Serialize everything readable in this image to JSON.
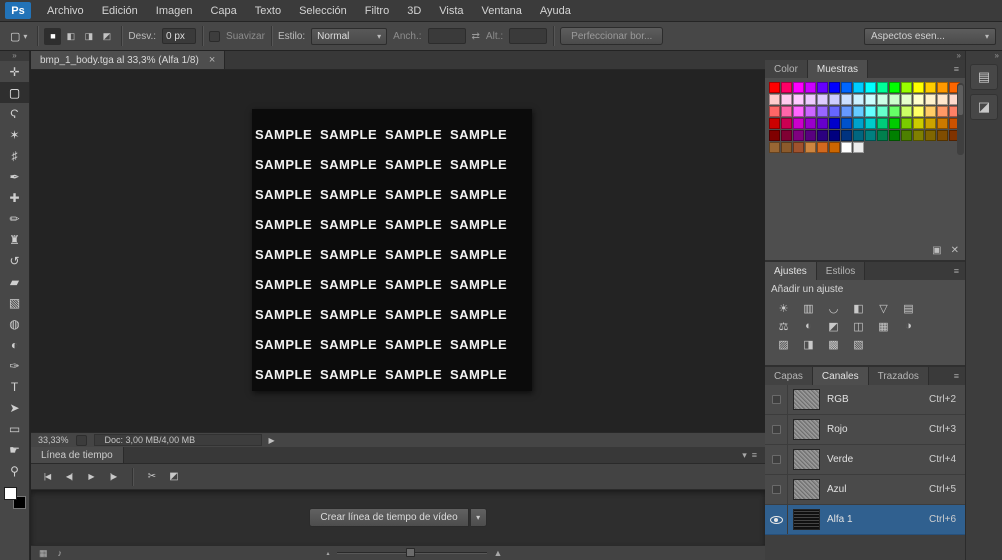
{
  "colors": {
    "selection_blue": "#30608f",
    "canvas_black": "#0b0b0b",
    "ui_gray": "#474747"
  },
  "ui_icons": {
    "dropdown": "▾",
    "panel_menu": "≡",
    "collapse": "»",
    "tool_preset": "▢",
    "swap": "⇄",
    "scissors": "✂",
    "transition": "◩",
    "status_arrow": "▶",
    "mountain_small": "▴",
    "mountain_large": "▲",
    "tab_close": "×"
  },
  "menu_bar": {
    "logo": "Ps",
    "menus": [
      "Archivo",
      "Edición",
      "Imagen",
      "Capa",
      "Texto",
      "Selección",
      "Filtro",
      "3D",
      "Vista",
      "Ventana",
      "Ayuda"
    ]
  },
  "options_bar": {
    "selection_modes": [
      {
        "name": "new-selection",
        "glyph": "■"
      },
      {
        "name": "add-to-selection",
        "glyph": "◧"
      },
      {
        "name": "subtract-from-selection",
        "glyph": "◨"
      },
      {
        "name": "intersect-selection",
        "glyph": "◩"
      }
    ],
    "feather_label": "Desv.:",
    "feather_value": "0 px",
    "antialias_label": "Suavizar",
    "style_label": "Estilo:",
    "style_value": "Normal",
    "width_label": "Anch.:",
    "width_value": "",
    "height_label": "Alt.:",
    "height_value": "",
    "refine_edge_label": "Perfeccionar bor...",
    "workspace_label": "Aspectos esen..."
  },
  "toolbar": {
    "tools": [
      {
        "name": "move-tool",
        "glyph": "✛"
      },
      {
        "name": "rectangular-marquee-tool",
        "glyph": "▢",
        "selected": true
      },
      {
        "name": "lasso-tool",
        "glyph": "Ϛ"
      },
      {
        "name": "quick-selection-tool",
        "glyph": "✶"
      },
      {
        "name": "crop-tool",
        "glyph": "♯"
      },
      {
        "name": "eyedropper-tool",
        "glyph": "✒"
      },
      {
        "name": "healing-brush-tool",
        "glyph": "✚"
      },
      {
        "name": "brush-tool",
        "glyph": "✏"
      },
      {
        "name": "clone-stamp-tool",
        "glyph": "♜"
      },
      {
        "name": "history-brush-tool",
        "glyph": "↺"
      },
      {
        "name": "eraser-tool",
        "glyph": "▰"
      },
      {
        "name": "gradient-tool",
        "glyph": "▧"
      },
      {
        "name": "blur-tool",
        "glyph": "◍"
      },
      {
        "name": "dodge-tool",
        "glyph": "◐"
      },
      {
        "name": "pen-tool",
        "glyph": "✑"
      },
      {
        "name": "type-tool",
        "glyph": "T"
      },
      {
        "name": "path-selection-tool",
        "glyph": "➤"
      },
      {
        "name": "shape-tool",
        "glyph": "▭"
      },
      {
        "name": "hand-tool",
        "glyph": "☛"
      },
      {
        "name": "zoom-tool",
        "glyph": "⚲"
      }
    ]
  },
  "document": {
    "tab_title": "bmp_1_body.tga al 33,3% (Alfa 1/8)",
    "canvas": {
      "text": "SAMPLE",
      "rows": 9,
      "cols": 4
    },
    "zoom_level": "33,33%",
    "doc_info": "Doc: 3,00 MB/4,00 MB"
  },
  "timeline": {
    "tab_label": "Línea de tiempo",
    "transport": [
      {
        "name": "first-frame",
        "glyph": "|◀"
      },
      {
        "name": "previous-frame",
        "glyph": "◀|"
      },
      {
        "name": "play",
        "glyph": "▶"
      },
      {
        "name": "next-frame",
        "glyph": "|▶"
      }
    ],
    "create_button_label": "Crear línea de tiempo de vídeo",
    "bottom_icons": [
      {
        "name": "timeline-frames",
        "glyph": "▦"
      },
      {
        "name": "timeline-audio",
        "glyph": "♪"
      }
    ]
  },
  "panels": {
    "color_panel": {
      "tabs": [
        {
          "label": "Color",
          "active": false
        },
        {
          "label": "Muestras",
          "active": true
        }
      ],
      "swatch_rows": [
        [
          "#ff0000",
          "#ff0066",
          "#ff00ff",
          "#cc00ff",
          "#6600ff",
          "#0000ff",
          "#0066ff",
          "#00ccff",
          "#00ffff",
          "#00ff99",
          "#00ff00",
          "#99ff00",
          "#ffff00",
          "#ffcc00",
          "#ff9900",
          "#ff6600"
        ],
        [
          "#ffcccc",
          "#ffccee",
          "#ffccff",
          "#eeccff",
          "#ddccff",
          "#ccccff",
          "#cce0ff",
          "#ccf2ff",
          "#ccffff",
          "#ccffe6",
          "#ccffcc",
          "#e6ffcc",
          "#ffffcc",
          "#fff2cc",
          "#ffe6cc",
          "#ffd9cc"
        ],
        [
          "#ff6666",
          "#ff66aa",
          "#ff66ff",
          "#cc66ff",
          "#9966ff",
          "#6666ff",
          "#6699ff",
          "#66ccff",
          "#66ffff",
          "#66ffcc",
          "#66ff66",
          "#ccff66",
          "#ffff66",
          "#ffcc66",
          "#ff9966",
          "#ff8066"
        ],
        [
          "#cc0000",
          "#cc0052",
          "#cc00cc",
          "#9900cc",
          "#6600cc",
          "#0000cc",
          "#0052cc",
          "#00a3cc",
          "#00cccc",
          "#00cc7a",
          "#00cc00",
          "#7acc00",
          "#cccc00",
          "#cca300",
          "#cc7a00",
          "#cc5200"
        ],
        [
          "#800000",
          "#800033",
          "#800080",
          "#590080",
          "#2b0080",
          "#000080",
          "#003380",
          "#006680",
          "#008080",
          "#00804d",
          "#008000",
          "#4d8000",
          "#808000",
          "#806600",
          "#804d00",
          "#803300"
        ],
        [
          "#996633",
          "#8b5a2b",
          "#a0522d",
          "#cd853f",
          "#d2691e",
          "#cc6600",
          "#ffffff",
          "#ebebeb"
        ]
      ],
      "footer_icons": [
        {
          "name": "new-swatch",
          "glyph": "▣"
        },
        {
          "name": "delete-swatch",
          "glyph": "✕"
        }
      ]
    },
    "adjustments_panel": {
      "tabs": [
        {
          "label": "Ajustes",
          "active": true
        },
        {
          "label": "Estilos",
          "active": false
        }
      ],
      "title": "Añadir un ajuste",
      "icons": [
        {
          "name": "brightness-contrast",
          "glyph": "☀"
        },
        {
          "name": "levels",
          "glyph": "▥"
        },
        {
          "name": "curves",
          "glyph": "◡"
        },
        {
          "name": "exposure",
          "glyph": "◧"
        },
        {
          "name": "vibrance",
          "glyph": "▽"
        },
        {
          "name": "hue-saturation",
          "glyph": "▤"
        },
        {
          "name": "color-balance",
          "glyph": "⚖"
        },
        {
          "name": "black-white",
          "glyph": "◐"
        },
        {
          "name": "photo-filter",
          "glyph": "◩"
        },
        {
          "name": "channel-mixer",
          "glyph": "◫"
        },
        {
          "name": "color-lookup",
          "glyph": "▦"
        },
        {
          "name": "invert",
          "glyph": "◑"
        },
        {
          "name": "posterize",
          "glyph": "▨"
        },
        {
          "name": "threshold",
          "glyph": "◨"
        },
        {
          "name": "gradient-map",
          "glyph": "▩"
        },
        {
          "name": "selective-color",
          "glyph": "▧"
        }
      ]
    },
    "channels_panel": {
      "tabs": [
        {
          "label": "Capas",
          "active": false
        },
        {
          "label": "Canales",
          "active": true
        },
        {
          "label": "Trazados",
          "active": false
        }
      ],
      "items": [
        {
          "name": "RGB",
          "shortcut": "Ctrl+2",
          "visible": false,
          "selected": false,
          "thumb": "noise"
        },
        {
          "name": "Rojo",
          "shortcut": "Ctrl+3",
          "visible": false,
          "selected": false,
          "thumb": "noise"
        },
        {
          "name": "Verde",
          "shortcut": "Ctrl+4",
          "visible": false,
          "selected": false,
          "thumb": "noise"
        },
        {
          "name": "Azul",
          "shortcut": "Ctrl+5",
          "visible": false,
          "selected": false,
          "thumb": "noise"
        },
        {
          "name": "Alfa 1",
          "shortcut": "Ctrl+6",
          "visible": true,
          "selected": true,
          "thumb": "alpha"
        }
      ]
    },
    "mini_dock_icons": [
      {
        "name": "collapsed-panel-1",
        "glyph": "▤"
      },
      {
        "name": "collapsed-panel-2",
        "glyph": "◪"
      }
    ]
  }
}
